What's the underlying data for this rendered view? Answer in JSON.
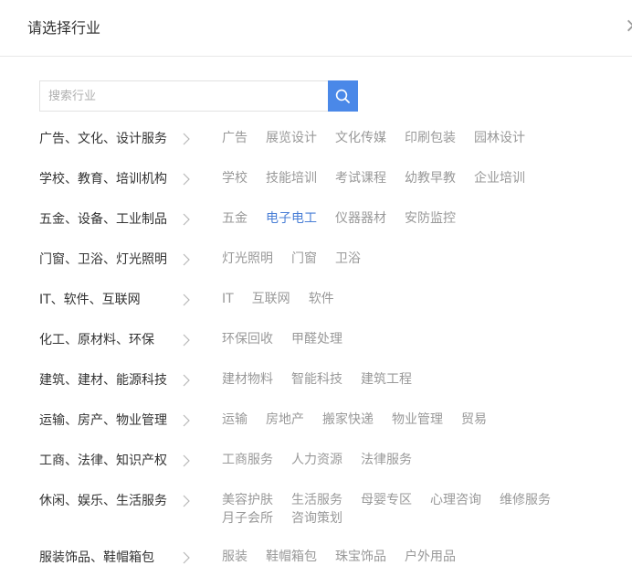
{
  "dialog": {
    "title": "请选择行业",
    "close_symbol": "×"
  },
  "search": {
    "placeholder": "搜索行业",
    "button_icon": "search-icon"
  },
  "colors": {
    "accent": "#4a88e8",
    "active_text": "#4a7fd6",
    "category_text": "#333333",
    "sub_text": "#999999"
  },
  "categories": [
    {
      "label": "广告、文化、设计服务",
      "subs": [
        {
          "label": "广告"
        },
        {
          "label": "展览设计"
        },
        {
          "label": "文化传媒"
        },
        {
          "label": "印刷包装"
        },
        {
          "label": "园林设计"
        }
      ]
    },
    {
      "label": "学校、教育、培训机构",
      "subs": [
        {
          "label": "学校"
        },
        {
          "label": "技能培训"
        },
        {
          "label": "考试课程"
        },
        {
          "label": "幼教早教"
        },
        {
          "label": "企业培训"
        }
      ]
    },
    {
      "label": "五金、设备、工业制品",
      "subs": [
        {
          "label": "五金"
        },
        {
          "label": "电子电工",
          "active": true
        },
        {
          "label": "仪器器材"
        },
        {
          "label": "安防监控"
        }
      ]
    },
    {
      "label": "门窗、卫浴、灯光照明",
      "subs": [
        {
          "label": "灯光照明"
        },
        {
          "label": "门窗"
        },
        {
          "label": "卫浴"
        }
      ]
    },
    {
      "label": "IT、软件、互联网",
      "subs": [
        {
          "label": "IT"
        },
        {
          "label": "互联网"
        },
        {
          "label": "软件"
        }
      ]
    },
    {
      "label": "化工、原材料、环保",
      "subs": [
        {
          "label": "环保回收"
        },
        {
          "label": "甲醛处理"
        }
      ]
    },
    {
      "label": "建筑、建材、能源科技",
      "subs": [
        {
          "label": "建材物料"
        },
        {
          "label": "智能科技"
        },
        {
          "label": "建筑工程"
        }
      ]
    },
    {
      "label": "运输、房产、物业管理",
      "subs": [
        {
          "label": "运输"
        },
        {
          "label": "房地产"
        },
        {
          "label": "搬家快递"
        },
        {
          "label": "物业管理"
        },
        {
          "label": "贸易"
        }
      ]
    },
    {
      "label": "工商、法律、知识产权",
      "subs": [
        {
          "label": "工商服务"
        },
        {
          "label": "人力资源"
        },
        {
          "label": "法律服务"
        }
      ]
    },
    {
      "label": "休闲、娱乐、生活服务",
      "subs": [
        {
          "label": "美容护肤"
        },
        {
          "label": "生活服务"
        },
        {
          "label": "母婴专区"
        },
        {
          "label": "心理咨询"
        },
        {
          "label": "维修服务"
        },
        {
          "label": "月子会所"
        },
        {
          "label": "咨询策划"
        }
      ]
    },
    {
      "label": "服装饰品、鞋帽箱包",
      "subs": [
        {
          "label": "服装"
        },
        {
          "label": "鞋帽箱包"
        },
        {
          "label": "珠宝饰品"
        },
        {
          "label": "户外用品"
        }
      ]
    }
  ]
}
